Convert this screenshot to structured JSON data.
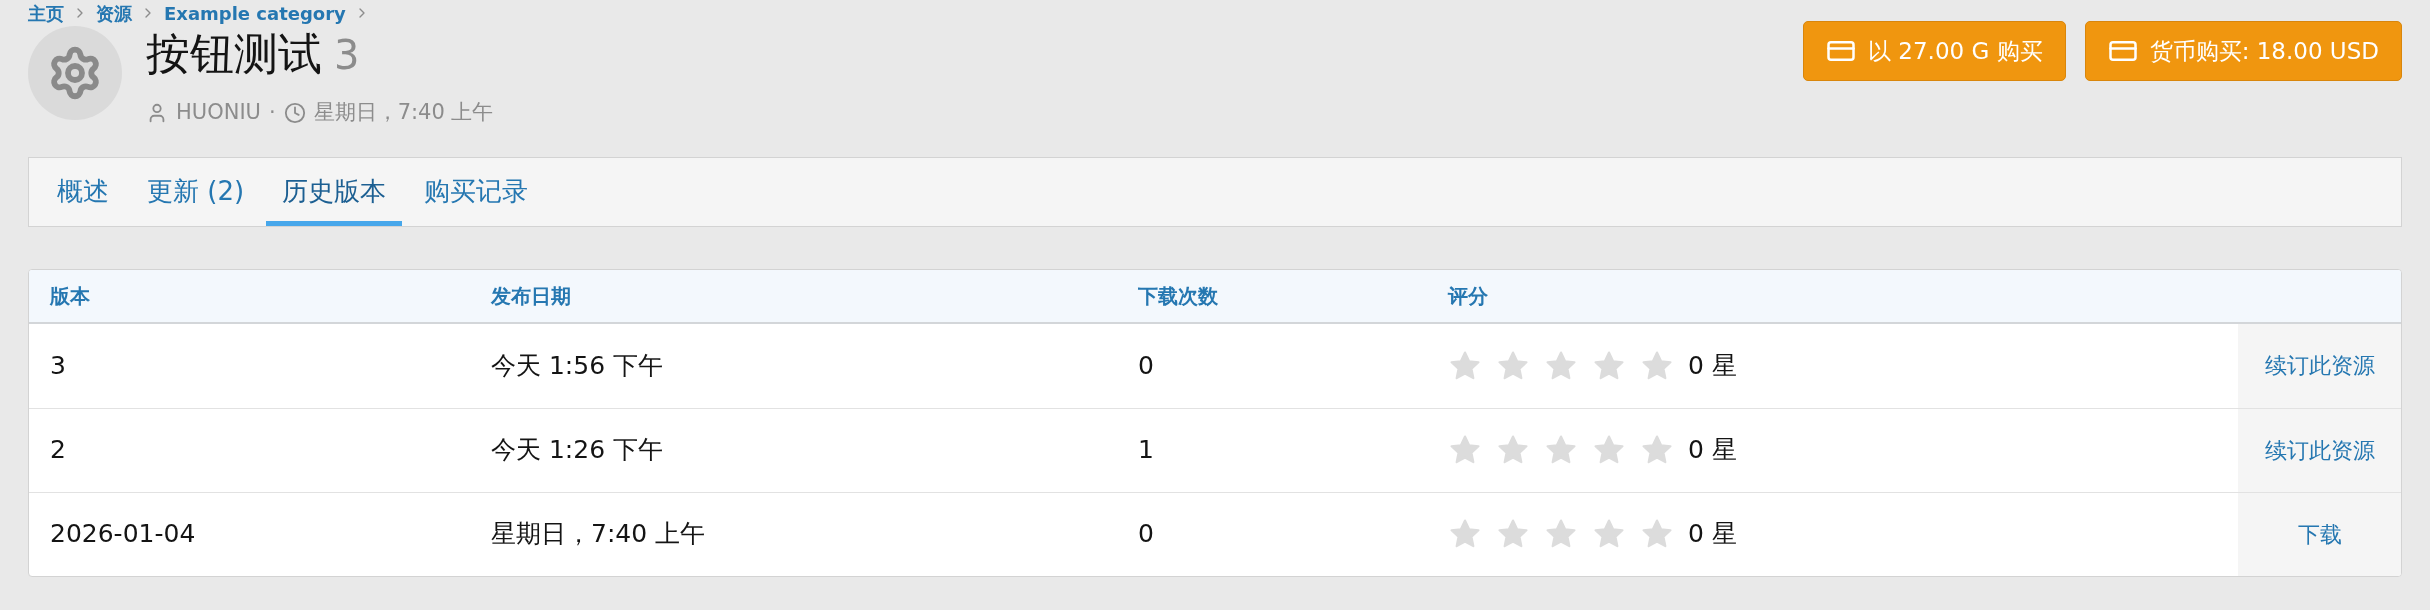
{
  "breadcrumb": [
    "主页",
    "资源",
    "Example category"
  ],
  "header": {
    "title": "按钮测试",
    "version": "3",
    "author": "HUONIU",
    "separator": "·",
    "date": "星期日，7:40 上午"
  },
  "buy_buttons": [
    "以 27.00 G 购买",
    "货币购买: 18.00 USD"
  ],
  "tabs": [
    {
      "label": "概述",
      "selected": false
    },
    {
      "label": "更新 (2)",
      "selected": false
    },
    {
      "label": "历史版本",
      "selected": true
    },
    {
      "label": "购买记录",
      "selected": false
    }
  ],
  "table": {
    "columns": [
      "版本",
      "发布日期",
      "下载次数",
      "评分"
    ],
    "rows": [
      {
        "version": "3",
        "date": "今天 1:56 下午",
        "downloads": "0",
        "stars": 0,
        "rating": "0 星",
        "action": "续订此资源"
      },
      {
        "version": "2",
        "date": "今天 1:26 下午",
        "downloads": "1",
        "stars": 0,
        "rating": "0 星",
        "action": "续订此资源"
      },
      {
        "version": "2026-01-04",
        "date": "星期日，7:40 上午",
        "downloads": "0",
        "stars": 0,
        "rating": "0 星",
        "action": "下载"
      }
    ]
  }
}
